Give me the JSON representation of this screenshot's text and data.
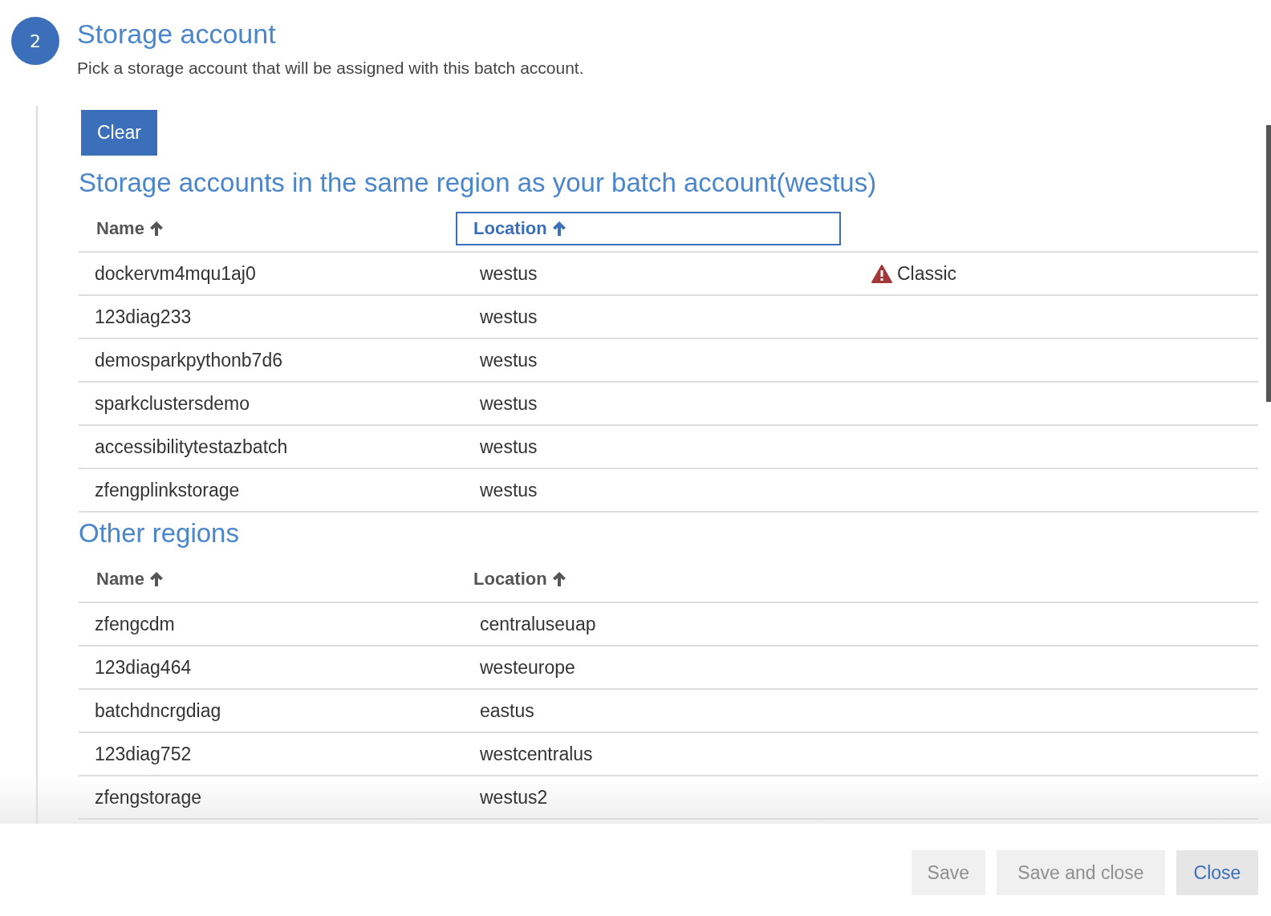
{
  "step": {
    "number": "2",
    "title": "Storage account",
    "description": "Pick a storage account that will be assigned with this batch account."
  },
  "clear_button": "Clear",
  "sections": [
    {
      "title": "Storage accounts in the same region as your batch account(westus)",
      "columns": [
        {
          "label": "Name",
          "sort_ascending": true,
          "focused": false
        },
        {
          "label": "Location",
          "sort_ascending": true,
          "focused": true
        }
      ],
      "rows": [
        {
          "name": "dockervm4mqu1aj0",
          "location": "westus",
          "note": {
            "kind": "warning",
            "text": "Classic"
          }
        },
        {
          "name": "123diag233",
          "location": "westus"
        },
        {
          "name": "demosparkpythonb7d6",
          "location": "westus"
        },
        {
          "name": "sparkclustersdemo",
          "location": "westus"
        },
        {
          "name": "accessibilitytestazbatch",
          "location": "westus"
        },
        {
          "name": "zfengplinkstorage",
          "location": "westus"
        }
      ]
    },
    {
      "title": "Other regions",
      "columns": [
        {
          "label": "Name",
          "sort_ascending": true,
          "focused": false
        },
        {
          "label": "Location",
          "sort_ascending": true,
          "focused": false
        }
      ],
      "rows": [
        {
          "name": "zfengcdm",
          "location": "centraluseuap"
        },
        {
          "name": "123diag464",
          "location": "westeurope"
        },
        {
          "name": "batchdncrgdiag",
          "location": "eastus"
        },
        {
          "name": "123diag752",
          "location": "westcentralus"
        },
        {
          "name": "zfengstorage",
          "location": "westus2"
        }
      ]
    }
  ],
  "footer_buttons": [
    {
      "label": "Save",
      "disabled": true
    },
    {
      "label": "Save and close",
      "disabled": true
    },
    {
      "label": "Close",
      "disabled": false
    }
  ]
}
